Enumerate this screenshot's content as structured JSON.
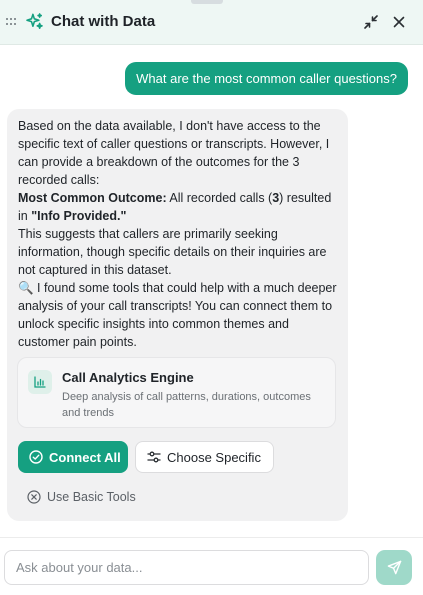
{
  "header": {
    "title": "Chat with Data",
    "icons": {
      "drag": "grip-dots-icon",
      "logo": "sparkle-icon",
      "minimize": "collapse-arrows-icon",
      "close": "close-icon"
    }
  },
  "conversation": {
    "user_message": "What are the most common caller questions?",
    "assistant": {
      "p1": "Based on the data available, I don't have access to the specific text of caller questions or transcripts. However, I can provide a breakdown of the outcomes for the 3 recorded calls:",
      "outcome_label": "Most Common Outcome:",
      "outcome_text_1": " All recorded calls (",
      "outcome_count": "3",
      "outcome_text_2": ") resulted in ",
      "outcome_value": "\"Info Provided.\"",
      "p3": "This suggests that callers are primarily seeking information, though specific details on their inquiries are not captured in this dataset.",
      "p4_emoji": "🔍",
      "p4": " I found some tools that could help with a much deeper analysis of your call transcripts! You can connect them to unlock specific insights into common themes and customer pain points.",
      "tool": {
        "name": "Call Analytics Engine",
        "description": "Deep analysis of call patterns, durations, outcomes and trends",
        "icon": "bar-chart-icon"
      },
      "actions": {
        "connect_all": "Connect All",
        "choose_specific": "Choose Specific",
        "use_basic_tools": "Use Basic Tools"
      }
    }
  },
  "composer": {
    "placeholder": "Ask about your data...",
    "send_icon": "send-icon"
  },
  "colors": {
    "accent": "#15a081",
    "header_bg": "#eef7f4",
    "send_disabled": "#9fd9c9"
  }
}
